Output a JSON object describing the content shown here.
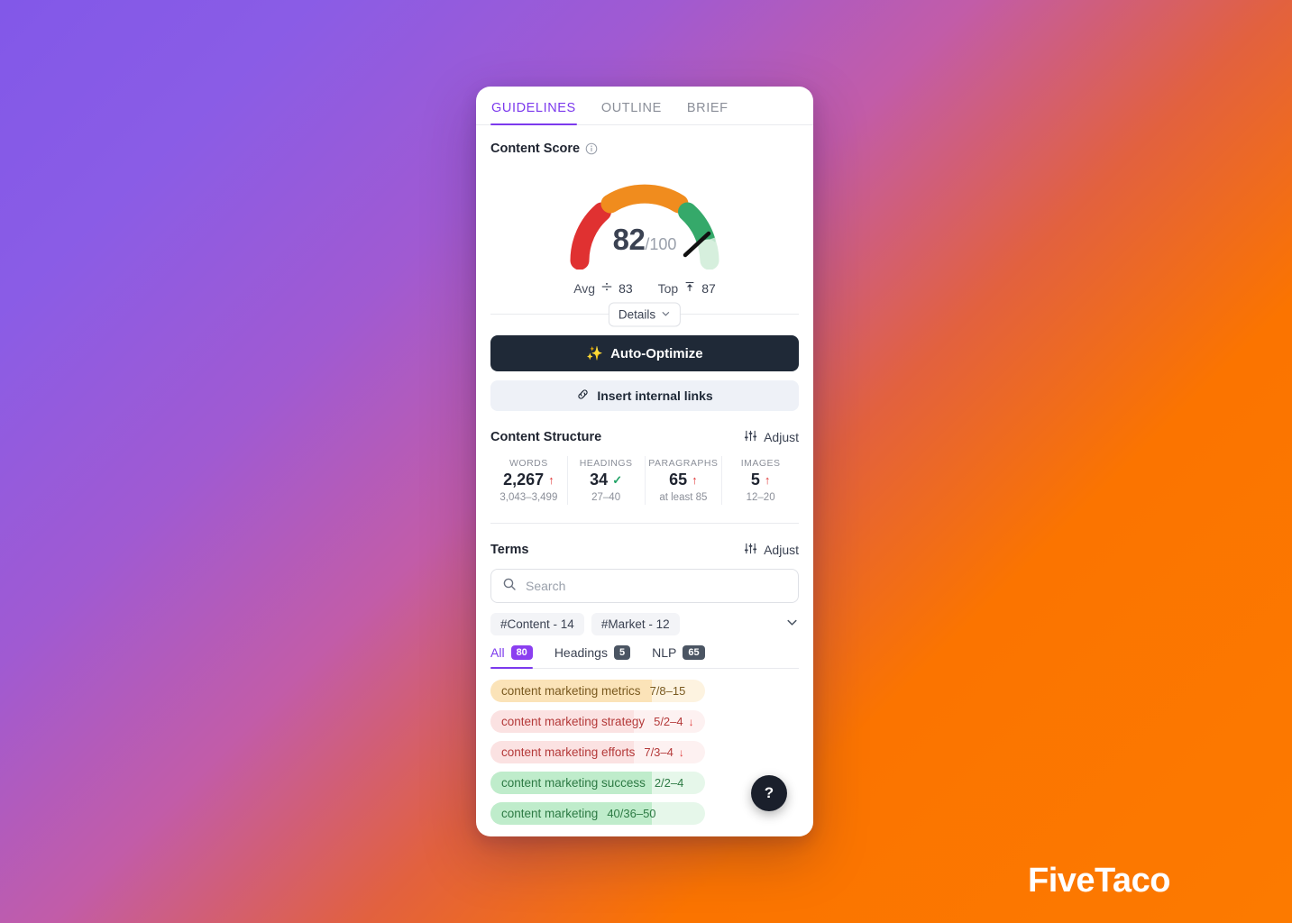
{
  "tabs": [
    {
      "label": "GUIDELINES",
      "active": true
    },
    {
      "label": "OUTLINE",
      "active": false
    },
    {
      "label": "BRIEF",
      "active": false
    }
  ],
  "content_score": {
    "title": "Content Score",
    "info_icon": "info-circle-icon",
    "value": "82",
    "denominator": "/100",
    "avg_label": "Avg",
    "avg_value": "83",
    "avg_icon": "average-icon",
    "top_label": "Top",
    "top_value": "87",
    "top_icon": "arrow-up-to-line-icon",
    "details_label": "Details",
    "details_chevron": "chevron-down-icon",
    "gauge": {
      "segments": [
        {
          "name": "low",
          "color": "#e03131"
        },
        {
          "name": "medium",
          "color": "#f08c1e"
        },
        {
          "name": "high",
          "color": "#35a96a"
        },
        {
          "name": "remainder",
          "color": "#d6efdd"
        }
      ],
      "needle_color": "#111111"
    }
  },
  "actions": {
    "auto_optimize_label": "Auto-Optimize",
    "auto_optimize_icon": "sparkles-icon",
    "insert_links_label": "Insert internal links",
    "insert_links_icon": "link-icon"
  },
  "content_structure": {
    "title": "Content Structure",
    "adjust_label": "Adjust",
    "adjust_icon": "sliders-icon",
    "metrics": [
      {
        "label": "WORDS",
        "value": "2,267",
        "status": "up",
        "range": "3,043–3,499"
      },
      {
        "label": "HEADINGS",
        "value": "34",
        "status": "check",
        "range": "27–40"
      },
      {
        "label": "PARAGRAPHS",
        "value": "65",
        "status": "up",
        "range": "at least 85"
      },
      {
        "label": "IMAGES",
        "value": "5",
        "status": "up",
        "range": "12–20"
      }
    ]
  },
  "terms": {
    "title": "Terms",
    "adjust_label": "Adjust",
    "adjust_icon": "sliders-icon",
    "search": {
      "placeholder": "Search",
      "value": "",
      "icon": "search-icon"
    },
    "chips": [
      {
        "label": "#Content - 14"
      },
      {
        "label": "#Market - 12"
      }
    ],
    "chips_more_icon": "chevron-down-icon",
    "subtabs": [
      {
        "label": "All",
        "badge": "80",
        "active": true
      },
      {
        "label": "Headings",
        "badge": "5",
        "active": false
      },
      {
        "label": "NLP",
        "badge": "65",
        "active": false
      }
    ],
    "rows": [
      {
        "term": "content marketing metrics",
        "count": "7/8–15",
        "tone": "amber",
        "trend": ""
      },
      {
        "term": "content marketing strategy",
        "count": "5/2–4",
        "tone": "red",
        "trend": "↓"
      },
      {
        "term": "content marketing efforts",
        "count": "7/3–4",
        "tone": "red",
        "trend": "↓"
      },
      {
        "term": "content marketing success",
        "count": "2/2–4",
        "tone": "green",
        "trend": ""
      },
      {
        "term": "content marketing",
        "count": "40/36–50",
        "tone": "green",
        "trend": ""
      }
    ]
  },
  "help_button": {
    "label": "?",
    "icon": "question-mark-icon"
  },
  "branding": {
    "logo_text": "FiveTaco"
  },
  "theme": {
    "accent_purple": "#7c3aed",
    "dark": "#1f2937",
    "bg_start": "#8258e8",
    "bg_end": "#fb7400"
  }
}
